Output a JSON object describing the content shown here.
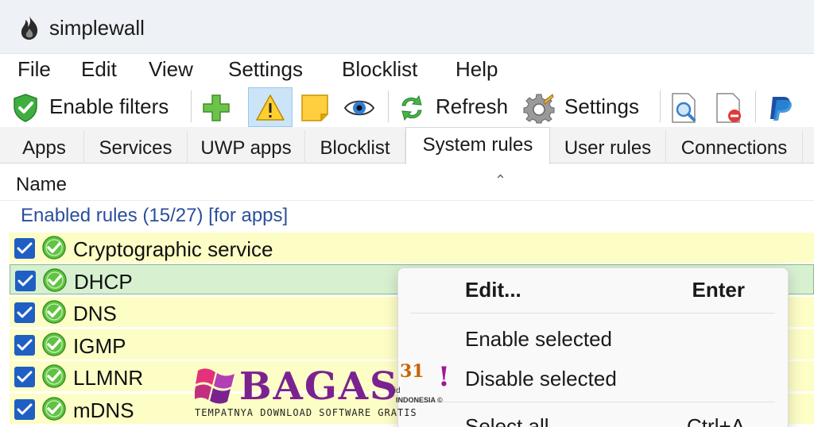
{
  "window": {
    "title": "simplewall"
  },
  "menu": [
    "File",
    "Edit",
    "View",
    "Settings",
    "Blocklist",
    "Help"
  ],
  "toolbar": {
    "enable_filters": "Enable filters",
    "refresh": "Refresh",
    "settings": "Settings"
  },
  "tabs": [
    "Apps",
    "Services",
    "UWP apps",
    "Blocklist",
    "System rules",
    "User rules",
    "Connections"
  ],
  "active_tab": "System rules",
  "list": {
    "column_name": "Name",
    "group_header": "Enabled rules (15/27) [for apps]",
    "rows": [
      {
        "label": "Cryptographic service"
      },
      {
        "label": "DHCP"
      },
      {
        "label": "DNS"
      },
      {
        "label": "IGMP"
      },
      {
        "label": "LLMNR"
      },
      {
        "label": "mDNS"
      }
    ]
  },
  "context_menu": {
    "edit": "Edit...",
    "edit_shortcut": "Enter",
    "enable_selected": "Enable selected",
    "disable_selected": "Disable selected",
    "select_all": "Select all",
    "select_all_shortcut": "Ctrl+A"
  },
  "watermark": {
    "brand": "BAGAS",
    "number": "31",
    "exclaim": "!",
    "domain": ".id",
    "country": "INDONESIA ©",
    "tagline": "TEMPATNYA DOWNLOAD SOFTWARE GRATIS"
  },
  "colors": {
    "row_background": "#fdfdc6",
    "selected_row": "#d7f0d0",
    "group_header": "#2a4f9c",
    "checkbox": "#1f5fc4"
  }
}
